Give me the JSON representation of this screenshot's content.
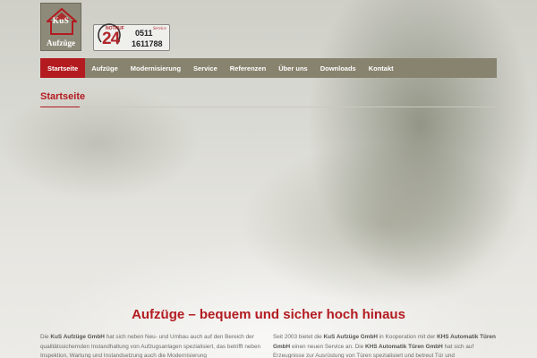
{
  "brand": {
    "logo_initials": "KuS",
    "logo_word": "Aufzüge"
  },
  "emergency": {
    "label": "NOTRUF",
    "hours": "24",
    "area_code": "0511",
    "number": "1611788",
    "tagline": "Service"
  },
  "nav": {
    "items": [
      {
        "label": "Startseite",
        "active": true
      },
      {
        "label": "Aufzüge",
        "active": false
      },
      {
        "label": "Modernisierung",
        "active": false
      },
      {
        "label": "Service",
        "active": false
      },
      {
        "label": "Referenzen",
        "active": false
      },
      {
        "label": "Über uns",
        "active": false
      },
      {
        "label": "Downloads",
        "active": false
      },
      {
        "label": "Kontakt",
        "active": false
      }
    ]
  },
  "page": {
    "title": "Startseite",
    "headline": "Aufzüge – bequem und sicher hoch hinaus"
  },
  "content": {
    "left": {
      "t1": "Die ",
      "b1": "KuS Aufzüge GmbH",
      "t2": " hat sich neben Neu- und Umbau auch auf den Bereich der qualitätssichernden Instandhaltung von Aufzugsanlagen spezialisiert, das betrifft neben Inspektion, Wartung und Instandsetzung auch die Modernisierung"
    },
    "right": {
      "t1": "Seit 2003 bietet die ",
      "b1": "KuS Aufzüge GmbH",
      "t2": " in Kooperation mit der ",
      "b2": "KHS Automatik Türen GmbH",
      "t3": " einen neuen Service an. Die ",
      "b3": "KHS Automatik Türen GmbH",
      "t4": " hat sich auf Erzeugnisse zur Ausrüstung von Türen spezialisiert und betreut Tür und"
    }
  },
  "colors": {
    "accent": "#b31b20",
    "nav_background": "#88836e",
    "logo_background": "#8e8a79"
  }
}
